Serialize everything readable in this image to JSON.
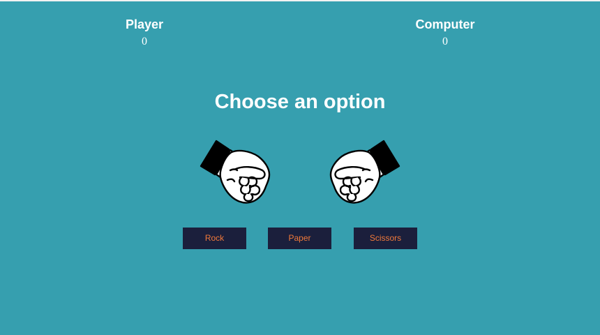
{
  "scoreboard": {
    "player_label": "Player",
    "player_score": "0",
    "computer_label": "Computer",
    "computer_score": "0"
  },
  "prompt": "Choose an option",
  "hands": {
    "player_icon": "fist-icon",
    "computer_icon": "fist-icon"
  },
  "options": {
    "rock_label": "Rock",
    "paper_label": "Paper",
    "scissors_label": "Scissors"
  },
  "colors": {
    "background": "#369faf",
    "button_bg": "#1b1f3c",
    "button_text": "#f0793a",
    "text": "#ffffff"
  }
}
